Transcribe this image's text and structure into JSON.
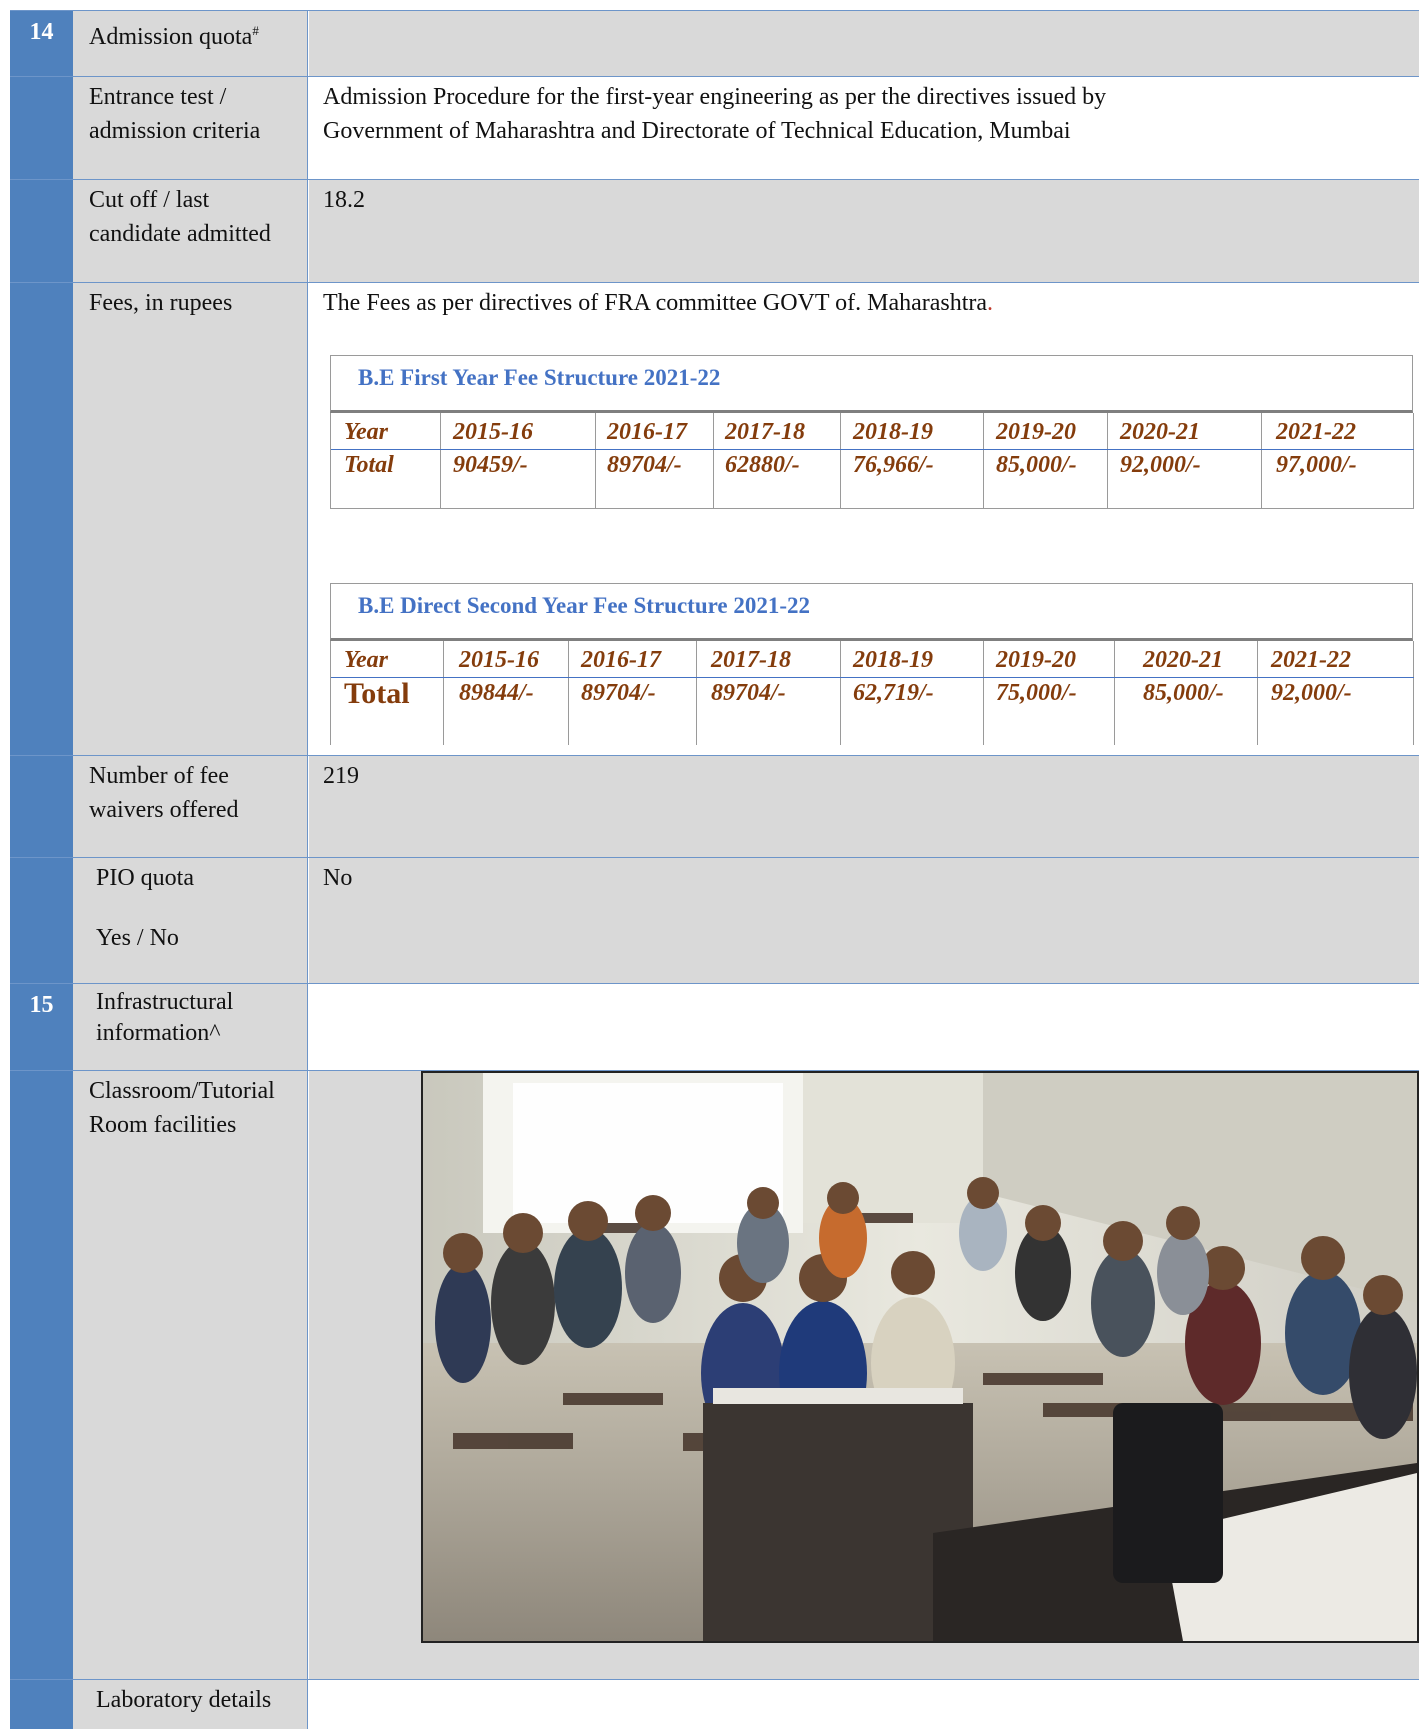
{
  "rows": {
    "admission_quota": {
      "number": "14",
      "label": "Admission quota",
      "label_sup": "#"
    },
    "entrance": {
      "label_line1": "Entrance test /",
      "label_line2": "admission criteria",
      "value_line1": "Admission Procedure for the first-year engineering as per the directives issued by",
      "value_line2": "Government of Maharashtra and Directorate of Technical Education, Mumbai"
    },
    "cutoff": {
      "label_line1": "Cut off / last",
      "label_line2": "candidate admitted",
      "value": "18.2"
    },
    "fees": {
      "label": "Fees, in rupees",
      "value": "The Fees as per directives of FRA committee GOVT of. Maharashtra",
      "value_end": "."
    },
    "waivers": {
      "label_line1": "Number of fee",
      "label_line2": "waivers offered",
      "value": "219"
    },
    "pio": {
      "label_line1": "PIO quota",
      "label_line2": "Yes / No",
      "value": "No"
    },
    "infra": {
      "number": "15",
      "label_line1": "Infrastructural",
      "label_line2": "information^"
    },
    "classroom": {
      "label_line1": "Classroom/Tutorial",
      "label_line2": "Room facilities"
    },
    "lab": {
      "label": "Laboratory details"
    }
  },
  "fee_tables": [
    {
      "title": "B.E First Year Fee Structure 2021-22",
      "row_label_year": "Year",
      "row_label_total": "Total",
      "years": [
        "2015-16",
        "2016-17",
        "2017-18",
        "2018-19",
        "2019-20",
        "2020-21",
        "2021-22"
      ],
      "totals": [
        "90459/-",
        "89704/-",
        "62880/-",
        "76,966/-",
        "85,000/-",
        "92,000/-",
        "97,000/-"
      ]
    },
    {
      "title": "B.E Direct Second Year Fee Structure 2021-22",
      "row_label_year": "Year",
      "row_label_total": "Total",
      "years": [
        "2015-16",
        "2016-17",
        "2017-18",
        "2018-19",
        "2019-20",
        "2020-21",
        "2021-22"
      ],
      "totals": [
        "89844/-",
        "89704/-",
        "89704/-",
        "62,719/-",
        "75,000/-",
        "85,000/-",
        "92,000/-"
      ]
    }
  ]
}
